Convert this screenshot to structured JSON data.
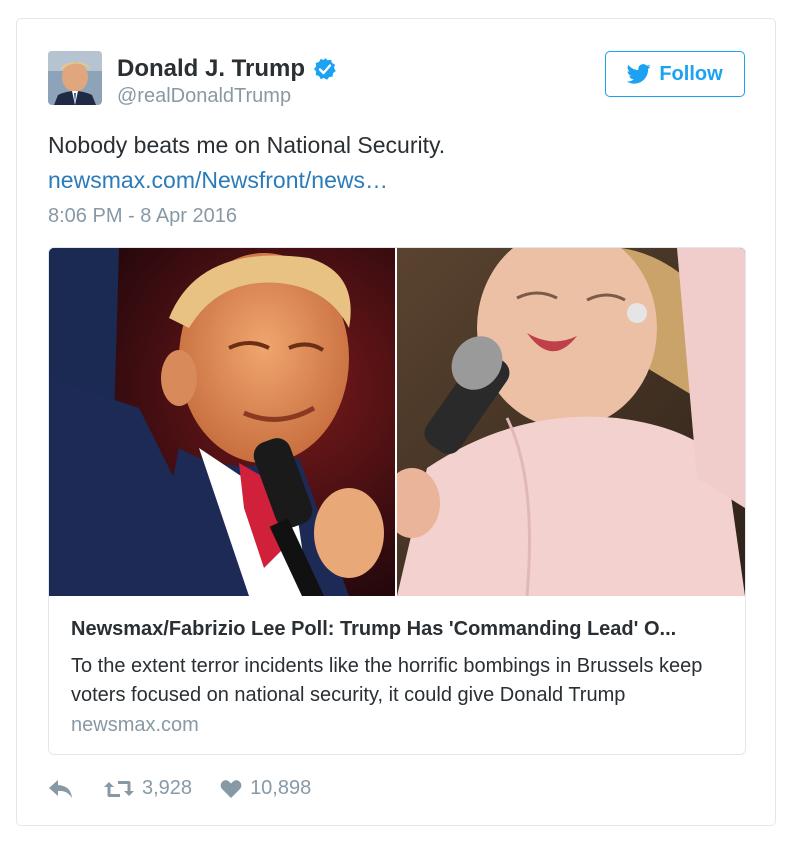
{
  "author": {
    "name": "Donald J. Trump",
    "handle": "@realDonaldTrump"
  },
  "follow_label": "Follow",
  "tweet": {
    "text": "Nobody beats me on National Security.",
    "link": "newsmax.com/Newsfront/news…",
    "timestamp": "8:06 PM - 8 Apr 2016"
  },
  "card": {
    "title": "Newsmax/Fabrizio Lee Poll: Trump Has 'Commanding Lead' O...",
    "description": "To the extent terror incidents like the horrific bombings in Brussels keep voters focused on national security, it could give Donald Trump",
    "domain": "newsmax.com"
  },
  "actions": {
    "retweets": "3,928",
    "likes": "10,898"
  },
  "icons": {
    "verified": "verified-badge-icon",
    "follow": "twitter-bird-icon",
    "reply": "reply-arrow-icon",
    "retweet": "retweet-icon",
    "like": "heart-icon"
  },
  "colors": {
    "brand_blue": "#1da1f2",
    "link_blue": "#2b7bb9",
    "muted_gray": "#8899a6",
    "text": "#292f33",
    "border": "#e1e8ed"
  }
}
